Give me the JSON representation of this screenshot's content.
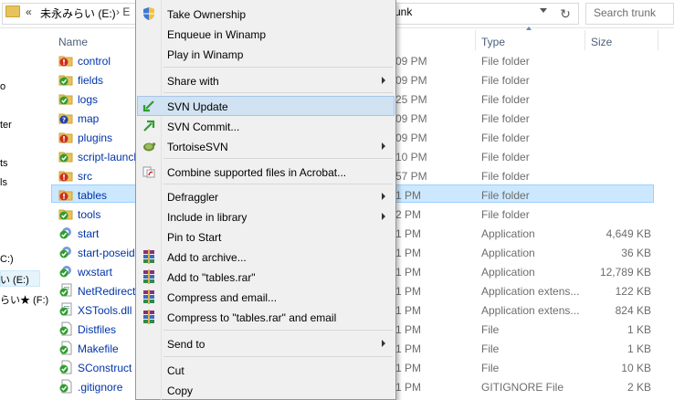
{
  "address_bar": {
    "chevron": "«",
    "drive": "未永みらい (E:)",
    "separator": "›  E",
    "tail": "unk",
    "refresh_glyph": "↻",
    "search_placeholder": "Search trunk"
  },
  "nav": {
    "items": [
      "o",
      "ter",
      "ts",
      "ls",
      "C:)",
      "い (E:)",
      "らい★ (F:)"
    ]
  },
  "columns": {
    "name": "Name",
    "type": "Type",
    "size": "Size"
  },
  "files": [
    {
      "name": "control",
      "date": "09 PM",
      "type": "File folder",
      "size": "",
      "icon": "svn-conflict-folder-icon"
    },
    {
      "name": "fields",
      "date": "09 PM",
      "type": "File folder",
      "size": "",
      "icon": "svn-normal-folder-icon"
    },
    {
      "name": "logs",
      "date": "25 PM",
      "type": "File folder",
      "size": "",
      "icon": "svn-normal-folder-icon"
    },
    {
      "name": "map",
      "date": "09 PM",
      "type": "File folder",
      "size": "",
      "icon": "svn-unversioned-folder-icon"
    },
    {
      "name": "plugins",
      "date": "09 PM",
      "type": "File folder",
      "size": "",
      "icon": "svn-conflict-folder-icon"
    },
    {
      "name": "script-launcher",
      "date": "10 PM",
      "type": "File folder",
      "size": "",
      "icon": "svn-normal-folder-icon"
    },
    {
      "name": "src",
      "date": "57 PM",
      "type": "File folder",
      "size": "",
      "icon": "svn-conflict-folder-icon"
    },
    {
      "name": "tables",
      "date": "1 PM",
      "type": "File folder",
      "size": "",
      "icon": "svn-conflict-folder-icon"
    },
    {
      "name": "tools",
      "date": "2 PM",
      "type": "File folder",
      "size": "",
      "icon": "svn-normal-folder-icon"
    },
    {
      "name": "start",
      "date": "1 PM",
      "type": "Application",
      "size": "4,649 KB",
      "icon": "svn-normal-app-icon"
    },
    {
      "name": "start-poseidon",
      "date": "1 PM",
      "type": "Application",
      "size": "36 KB",
      "icon": "svn-normal-app-icon"
    },
    {
      "name": "wxstart",
      "date": "1 PM",
      "type": "Application",
      "size": "12,789 KB",
      "icon": "svn-normal-app-icon"
    },
    {
      "name": "NetRedirect",
      "date": "1 PM",
      "type": "Application extens...",
      "size": "122 KB",
      "icon": "svn-normal-dll-icon"
    },
    {
      "name": "XSTools.dll",
      "date": "1 PM",
      "type": "Application extens...",
      "size": "824 KB",
      "icon": "svn-normal-dll-icon"
    },
    {
      "name": "Distfiles",
      "date": "1 PM",
      "type": "File",
      "size": "1 KB",
      "icon": "svn-normal-file-icon"
    },
    {
      "name": "Makefile",
      "date": "1 PM",
      "type": "File",
      "size": "1 KB",
      "icon": "svn-normal-file-icon"
    },
    {
      "name": "SConstruct",
      "date": "1 PM",
      "type": "File",
      "size": "10 KB",
      "icon": "svn-normal-file-icon"
    },
    {
      "name": ".gitignore",
      "date": "1 PM",
      "type": "GITIGNORE File",
      "size": "2 KB",
      "icon": "svn-normal-file-icon"
    }
  ],
  "menu": {
    "take_ownership": "Take Ownership",
    "enqueue_winamp": "Enqueue in Winamp",
    "play_winamp": "Play in Winamp",
    "share_with": "Share with",
    "svn_update": "SVN Update",
    "svn_commit": "SVN Commit...",
    "tortoisesvn": "TortoiseSVN",
    "combine_acrobat": "Combine supported files in Acrobat...",
    "defraggler": "Defraggler",
    "include_library": "Include in library",
    "pin_start": "Pin to Start",
    "add_archive": "Add to archive...",
    "add_tables_rar": "Add to \"tables.rar\"",
    "compress_email": "Compress and email...",
    "compress_tables_email": "Compress to \"tables.rar\" and email",
    "send_to": "Send to",
    "cut": "Cut",
    "copy": "Copy"
  },
  "colors": {
    "selection_bg": "#cce8ff",
    "menu_highlight": "#d1e2f2",
    "link_blue": "#0034a8"
  }
}
